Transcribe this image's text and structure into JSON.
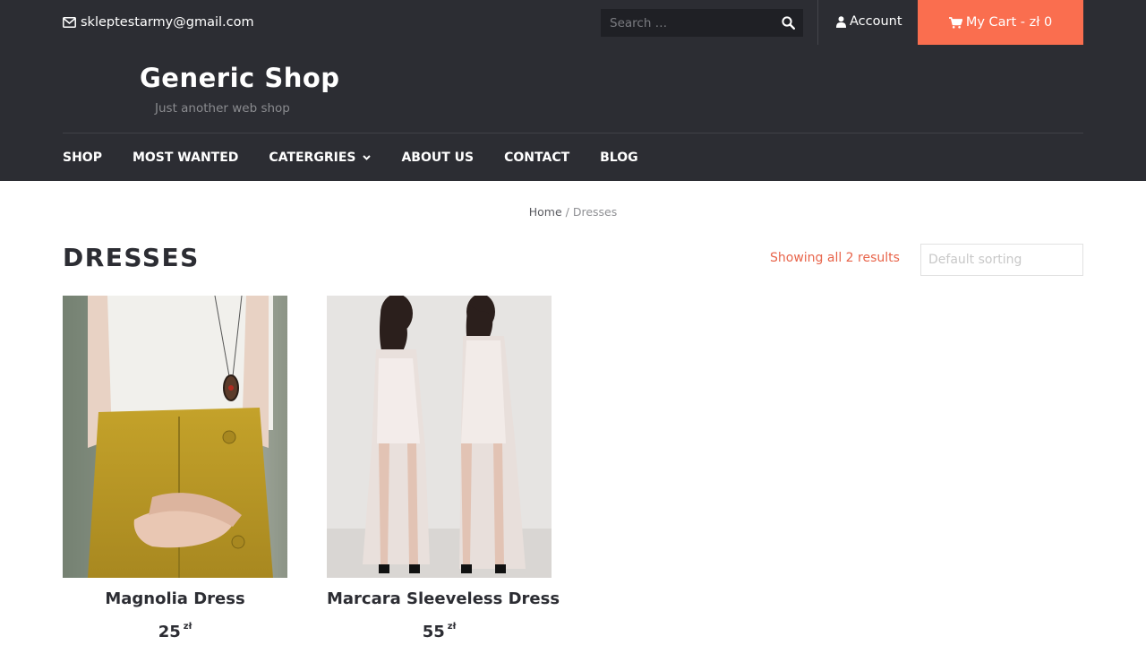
{
  "topbar": {
    "email": "skleptestarmy@gmail.com",
    "search_placeholder": "Search …",
    "account_label": "Account",
    "cart_label": "My Cart - zł 0"
  },
  "header": {
    "site_title": "Generic Shop",
    "tagline": "Just another web shop"
  },
  "nav": {
    "items": [
      {
        "label": "SHOP"
      },
      {
        "label": "MOST WANTED"
      },
      {
        "label": "CATERGRIES"
      },
      {
        "label": "ABOUT US"
      },
      {
        "label": "CONTACT"
      },
      {
        "label": "BLOG"
      }
    ]
  },
  "breadcrumb": {
    "home": "Home",
    "separator": "/",
    "current": "Dresses"
  },
  "main": {
    "page_title": "DRESSES",
    "result_count": "Showing all 2 results",
    "sort_selected": "Default sorting"
  },
  "products": [
    {
      "name": "Magnolia Dress",
      "price": "25",
      "currency": "zł"
    },
    {
      "name": "Marcara Sleeveless Dress",
      "price": "55",
      "currency": "zł"
    }
  ],
  "colors": {
    "dark": "#2c2d33",
    "accent": "#fa6e4f",
    "result_text": "#e8644a"
  }
}
